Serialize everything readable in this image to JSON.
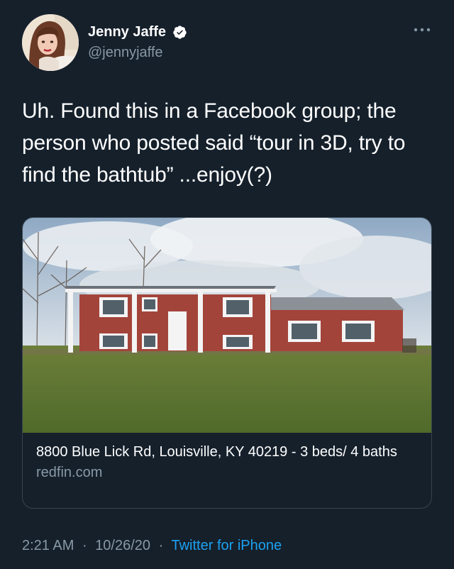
{
  "user": {
    "display_name": "Jenny Jaffe",
    "handle": "@jennyjaffe",
    "verified": true
  },
  "tweet": {
    "text": "Uh. Found this in a Facebook group; the person who posted said “tour in 3D, try to find the bathtub” ...enjoy(?)",
    "time": "2:21 AM",
    "date": "10/26/20",
    "separator": "·",
    "source": "Twitter for iPhone"
  },
  "link_card": {
    "title": "8800 Blue Lick Rd, Louisville, KY 40219 - 3 beds/ 4 baths",
    "domain": "redfin.com"
  },
  "icons": {
    "more": "more-options-icon",
    "verified": "verified-badge-icon"
  },
  "colors": {
    "background": "#15202b",
    "secondary_text": "#8899a6",
    "accent": "#1da1f2",
    "border": "#38444d"
  }
}
